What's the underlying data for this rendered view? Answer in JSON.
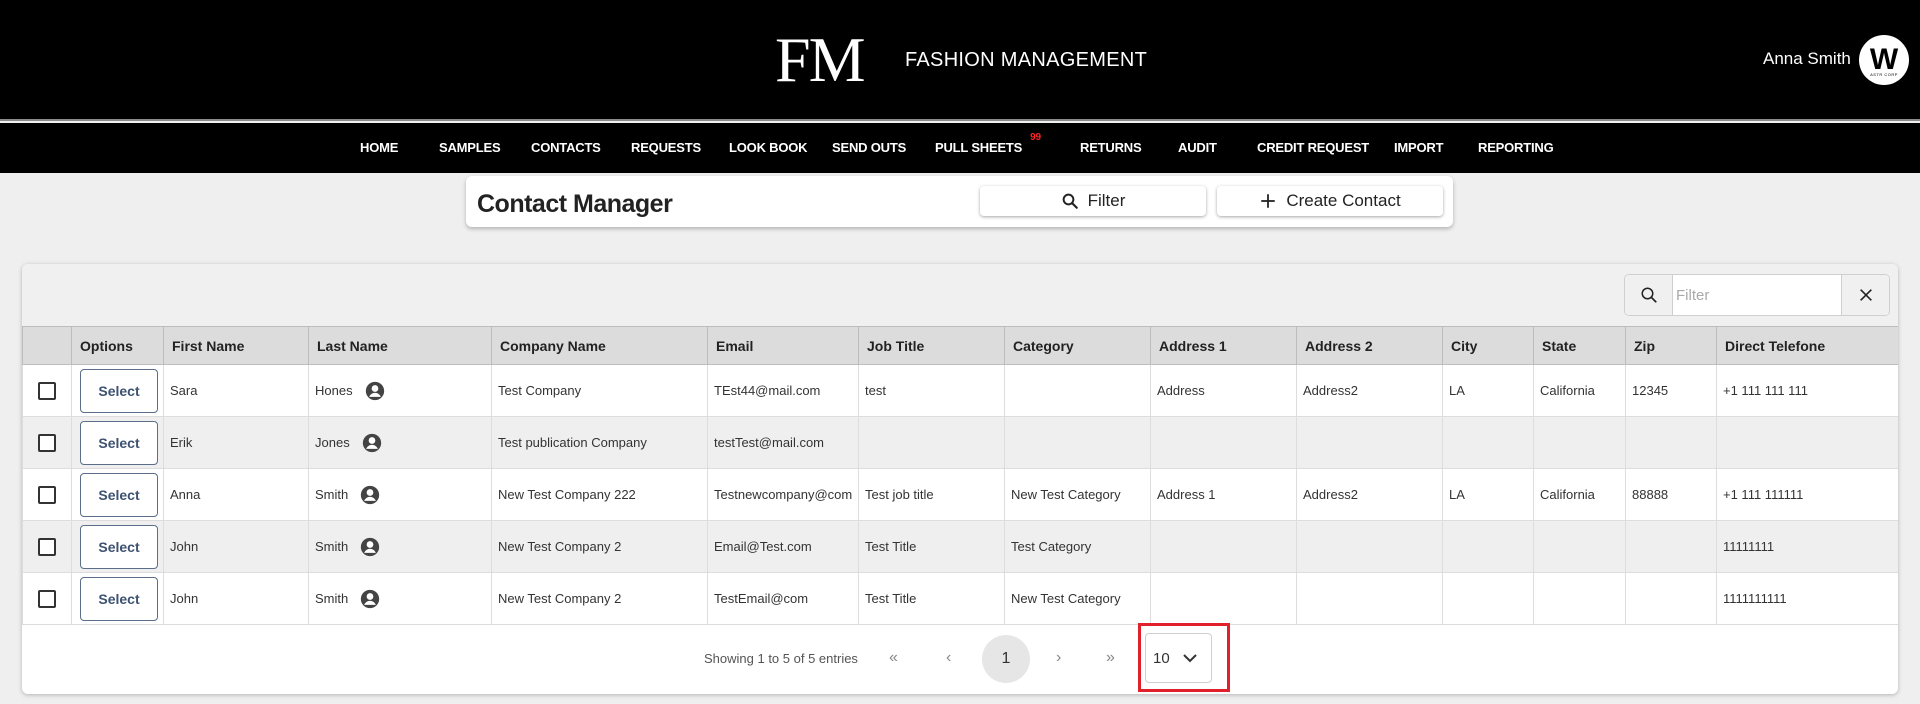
{
  "header": {
    "logo": "FM",
    "brand": "FASHION MANAGEMENT",
    "user_name": "Anna Smith",
    "avatar_letter": "W",
    "avatar_sub": "ASTR CORP"
  },
  "nav": {
    "items": [
      "HOME",
      "SAMPLES",
      "CONTACTS",
      "REQUESTS",
      "LOOK BOOK",
      "SEND OUTS",
      "PULL SHEETS",
      "RETURNS",
      "AUDIT",
      "CREDIT REQUEST",
      "IMPORT",
      "REPORTING"
    ],
    "pull_sheets_badge": "99"
  },
  "page": {
    "title": "Contact Manager",
    "filter_label": "Filter",
    "create_label": "Create Contact"
  },
  "search": {
    "placeholder": "Filter"
  },
  "table": {
    "headers": [
      "",
      "Options",
      "First Name",
      "Last Name",
      "Company Name",
      "Email",
      "Job Title",
      "Category",
      "Address 1",
      "Address 2",
      "City",
      "State",
      "Zip",
      "Direct Telefone"
    ],
    "select_label": "Select",
    "rows": [
      {
        "first": "Sara",
        "last": "Hones",
        "company": "Test Company",
        "email": "TEst44@mail.com",
        "job": "test",
        "category": "",
        "addr1": "Address",
        "addr2": "Address2",
        "city": "LA",
        "state": "California",
        "zip": "12345",
        "phone": "+1 111 111 111"
      },
      {
        "first": "Erik",
        "last": "Jones",
        "company": "Test publication Company",
        "email": "testTest@mail.com",
        "job": "",
        "category": "",
        "addr1": "",
        "addr2": "",
        "city": "",
        "state": "",
        "zip": "",
        "phone": ""
      },
      {
        "first": "Anna",
        "last": "Smith",
        "company": "New Test Company 222",
        "email": "Testnewcompany@com",
        "job": "Test job title",
        "category": "New Test Category",
        "addr1": "Address 1",
        "addr2": "Address2",
        "city": "LA",
        "state": "California",
        "zip": "88888",
        "phone": "+1 111 111111"
      },
      {
        "first": "John",
        "last": "Smith",
        "company": "New Test Company 2",
        "email": "Email@Test.com",
        "job": "Test Title",
        "category": "Test Category",
        "addr1": "",
        "addr2": "",
        "city": "",
        "state": "",
        "zip": "",
        "phone": "11111111"
      },
      {
        "first": "John",
        "last": "Smith",
        "company": "New Test Company 2",
        "email": "TestEmail@com",
        "job": "Test Title",
        "category": "New Test Category",
        "addr1": "",
        "addr2": "",
        "city": "",
        "state": "",
        "zip": "",
        "phone": "1111111111"
      }
    ]
  },
  "pagination": {
    "info": "Showing 1 to 5 of 5 entries",
    "current_page": "1",
    "page_size": "10"
  },
  "colors": {
    "highlight": "#e0202a",
    "badge": "#ff2424"
  }
}
